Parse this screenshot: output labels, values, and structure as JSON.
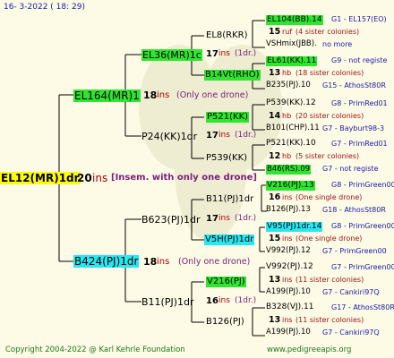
{
  "date": "16-  3-2022 ( 18: 29)",
  "copyright": "Copyright 2004-2022 @ Karl Kehrle Foundation",
  "site": "www.pedigreeapis.org",
  "root": {
    "name": "EL12(MR)1dr",
    "count": "20",
    "ins": "ins",
    "note": "[Insem. with only one drone]"
  },
  "g1": [
    {
      "name": "EL164(MR)1",
      "count": "18",
      "ins": "ins",
      "note": "(Only one drone)"
    },
    {
      "name": "B424(PJ)1dr",
      "count": "18",
      "ins": "ins",
      "note": "(Only one drone)"
    }
  ],
  "g2": [
    {
      "name": "EL36(MR)1c",
      "count": "17",
      "ins": "ins",
      "note": "(1dr.)"
    },
    {
      "name": "P24(KK)1dr",
      "count": "17",
      "ins": "ins",
      "note": "(1dr.)"
    },
    {
      "name": "B623(PJ)1dr",
      "count": "17",
      "ins": "ins",
      "note": "(1dr.)"
    },
    {
      "name": "B11(PJ)1dr",
      "count": "16",
      "ins": "ins",
      "note": "(1dr.)"
    }
  ],
  "g3": [
    {
      "name": "EL8(RKR)"
    },
    {
      "name": "B14Vt(RHO)"
    },
    {
      "name": "P521(KK)"
    },
    {
      "name": "P539(KK)"
    },
    {
      "name": "B11(PJ)1dr",
      "count": "17",
      "ins": "ins",
      "note": "(1dr.)"
    },
    {
      "name": "V5H(PJ)1dr"
    },
    {
      "name": "V216(PJ)"
    },
    {
      "name": "B126(PJ)"
    }
  ],
  "g4": [
    {
      "l1": "EL104(BB).14",
      "l1b": "G1 - EL157(EO)",
      "l2a": "15",
      "l2b": "ruf",
      "l2c": "(4 sister colonies)",
      "l3a": "VSHmix(JBB).",
      "l3b": "no more"
    },
    {
      "l1": "EL61(KK).11",
      "l1b": "G9 - not registe",
      "l2a": "13",
      "l2b": "hb",
      "l2c": "(18 sister colonies)",
      "l3a": "B235(PJ).10",
      "l3b": "G15 - AthosSt80R"
    },
    {
      "l1": "P539(KK).12",
      "l1b": "G8 - PrimRed01",
      "l2a": "14",
      "l2b": "hb",
      "l2c": "(20 sister colonies)",
      "l3a": "B101(CHP).11",
      "l3b": "G7 - Bayburt98-3"
    },
    {
      "l1": "P521(KK).10",
      "l1b": "G7 - PrimRed01",
      "l2a": "12",
      "l2b": "hb",
      "l2c": "(5 sister colonies)",
      "l3a": "B46(RS).09",
      "l3b": "G7 - not registe"
    },
    {
      "l1": "V216(PJ).13",
      "l1b": "G8 - PrimGreen00",
      "l2a": "16",
      "l2b": "ins",
      "l2c": "(One single drone)",
      "l3a": "B126(PJ).13",
      "l3b": "G18 - AthosSt80R"
    },
    {
      "l1": "V95(PJ)1dr.14",
      "l1b": "G8 - PrimGreen00",
      "l2a": "15",
      "l2b": "ins",
      "l2c": "(One single drone)",
      "l3a": "V992(PJ).12",
      "l3b": "G7 - PrimGreen00"
    },
    {
      "l1": "V992(PJ).12",
      "l1b": "G7 - PrimGreen00",
      "l2a": "13",
      "l2b": "ins",
      "l2c": "(11 sister colonies)",
      "l3a": "A199(PJ).10",
      "l3b": "G7 - Cankiri97Q"
    },
    {
      "l1": "B328(VJ).11",
      "l1b": "G17 - AthosSt80R",
      "l2a": "13",
      "l2b": "ins",
      "l2c": "(11 sister colonies)",
      "l3a": "A199(PJ).10",
      "l3b": "G7 - Cankiri97Q"
    }
  ]
}
